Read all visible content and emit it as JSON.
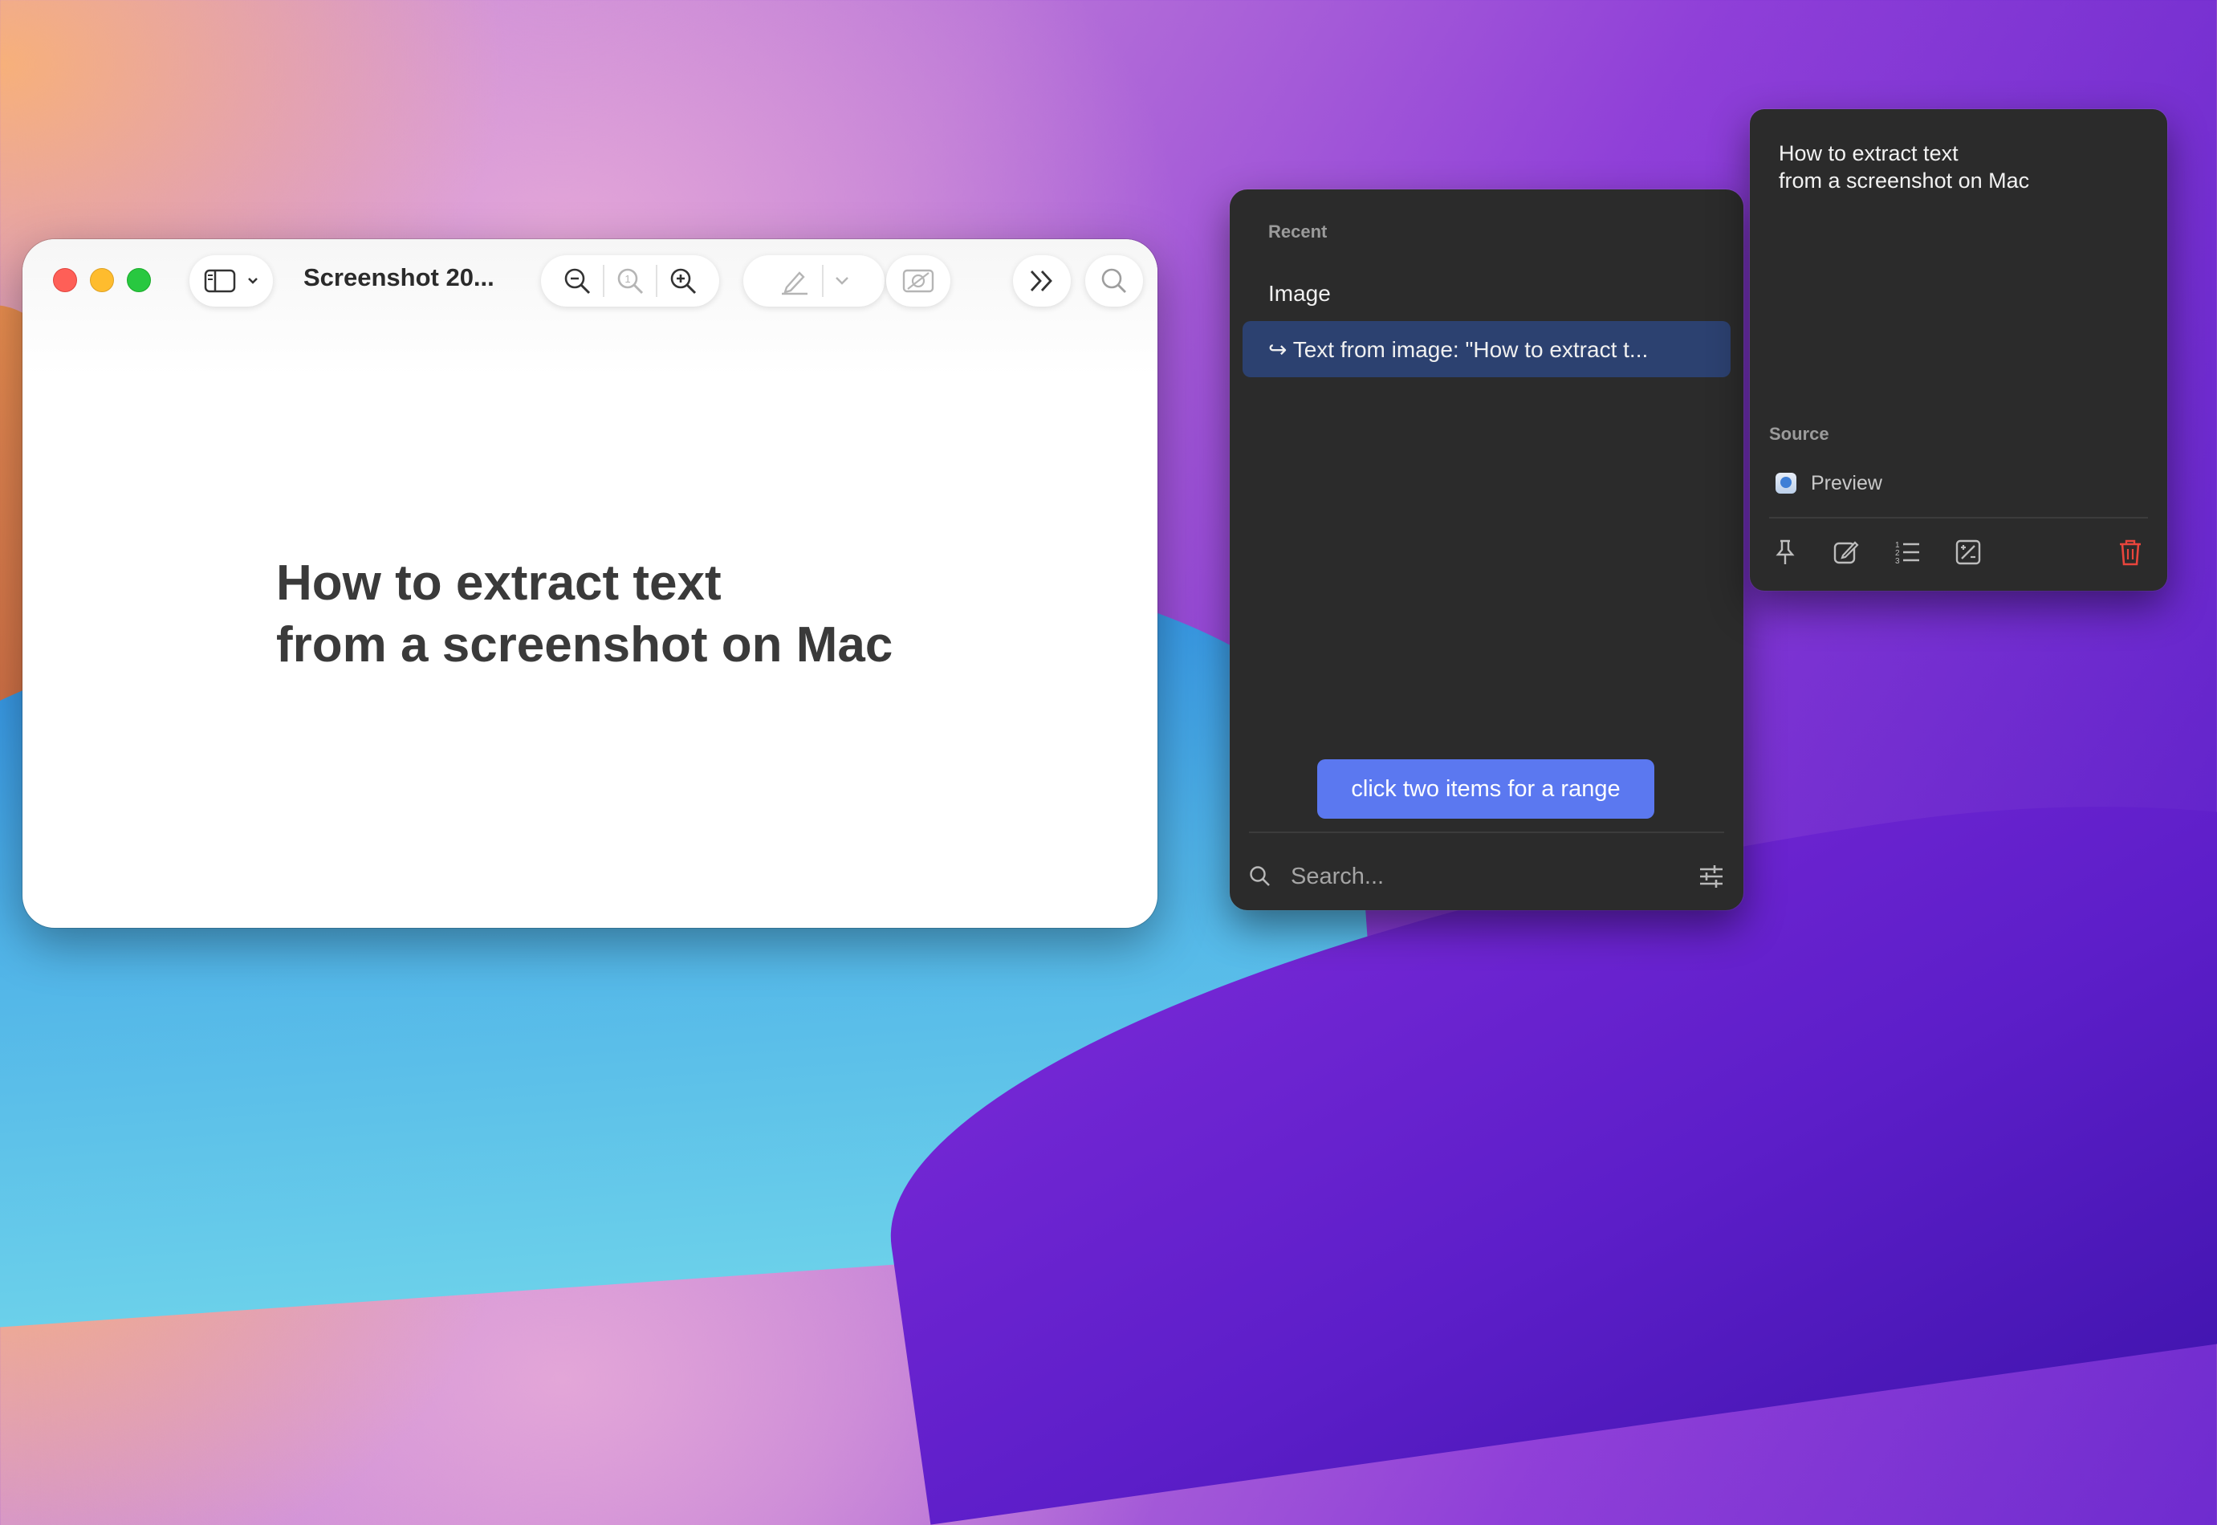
{
  "preview": {
    "window_title": "Screenshot 20...",
    "body_lines": [
      "How to extract text",
      "from a screenshot on Mac"
    ],
    "icons": [
      "sidebar-icon",
      "chevron-down-icon",
      "zoom-out-icon",
      "actual-size-icon",
      "zoom-in-icon",
      "markup-pen-icon",
      "chevron-down-icon",
      "image-edit-icon",
      "more-chevrons-icon",
      "search-icon"
    ]
  },
  "clipboard": {
    "section_label": "Recent",
    "items": [
      {
        "label": "Image"
      },
      {
        "label": "↪ Text from image: \"How to extract t..."
      }
    ],
    "range_hint": "click two items for a range",
    "search_placeholder": "Search...",
    "selected_color": "#2c4170",
    "accent_color": "#5b78f0"
  },
  "detail": {
    "lines": [
      "How to extract text",
      "from a screenshot on Mac"
    ],
    "source_label": "Source",
    "source_app": "Preview",
    "actions": [
      "pin-icon",
      "edit-icon",
      "numbered-list-icon",
      "transform-icon",
      "trash-icon"
    ],
    "delete_color": "#e8453c"
  }
}
